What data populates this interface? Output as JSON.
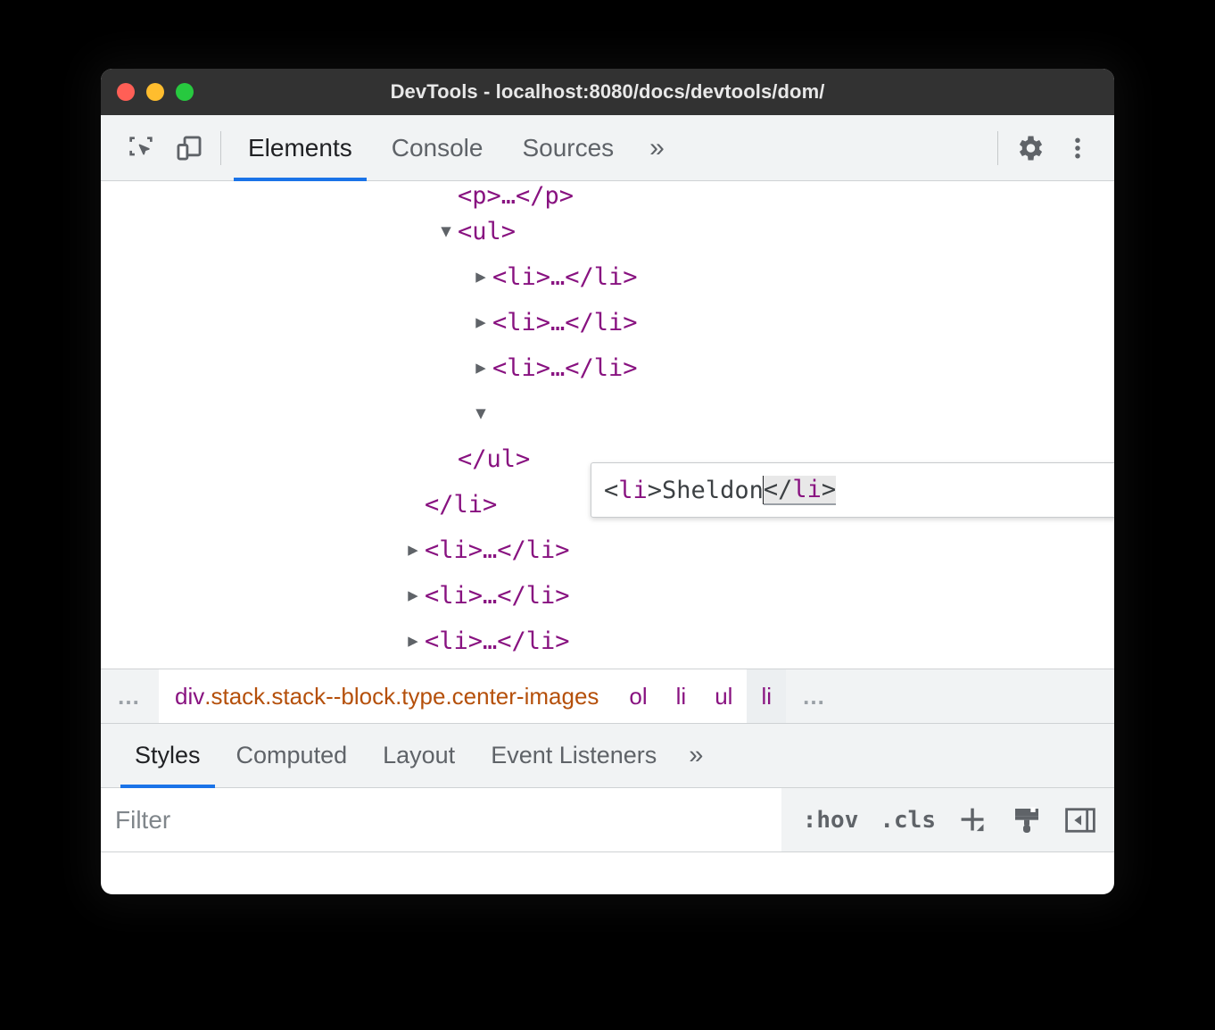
{
  "window": {
    "title": "DevTools - localhost:8080/docs/devtools/dom/",
    "traffic_lights": [
      {
        "name": "close",
        "color": "#ff5f56"
      },
      {
        "name": "minimize",
        "color": "#ffbd2e"
      },
      {
        "name": "zoom",
        "color": "#27c93f"
      }
    ]
  },
  "toolbar": {
    "inspect_icon": "inspect-element-icon",
    "device_icon": "device-toolbar-icon",
    "settings_icon": "gear-icon",
    "more_icon": "kebab-menu-icon",
    "tabs": [
      {
        "label": "Elements",
        "active": true
      },
      {
        "label": "Console",
        "active": false
      },
      {
        "label": "Sources",
        "active": false
      }
    ],
    "more_tabs_label": "»"
  },
  "dom_tree": {
    "rows": [
      {
        "id": "p-row",
        "twisty": "",
        "indent": 3,
        "text": "<p>…</p>",
        "clipped": true
      },
      {
        "id": "ul-open",
        "twisty": "▼",
        "indent": 3,
        "text": "<ul>"
      },
      {
        "id": "li-1",
        "twisty": "▶",
        "indent": 4,
        "text": "<li>…</li>"
      },
      {
        "id": "li-2",
        "twisty": "▶",
        "indent": 4,
        "text": "<li>…</li>"
      },
      {
        "id": "li-3",
        "twisty": "▶",
        "indent": 4,
        "text": "<li>…</li>"
      },
      {
        "id": "li-4-editing",
        "twisty": "▼",
        "indent": 4,
        "text": ""
      },
      {
        "id": "ul-close",
        "twisty": "",
        "indent": 3,
        "text": "</ul>"
      },
      {
        "id": "li-close",
        "twisty": "",
        "indent": 2,
        "text": "</li>"
      },
      {
        "id": "li-5",
        "twisty": "▶",
        "indent": 2,
        "text": "<li>…</li>"
      },
      {
        "id": "li-6",
        "twisty": "▶",
        "indent": 2,
        "text": "<li>…</li>"
      },
      {
        "id": "li-7",
        "twisty": "▶",
        "indent": 2,
        "text": "<li>…</li>"
      }
    ]
  },
  "editor": {
    "open_lt": "<",
    "open_tag": "li",
    "open_gt": ">",
    "content": "Sheldon",
    "close_lt": "</",
    "close_tag": "li",
    "close_gt": ">",
    "full_value": "<li>Sheldon</li>"
  },
  "breadcrumb": {
    "left_ellipsis": "…",
    "items": [
      {
        "tag": "div",
        "classes": ".stack.stack--block.type.center-images",
        "selected": false,
        "wide": true
      },
      {
        "tag": "ol",
        "classes": "",
        "selected": false
      },
      {
        "tag": "li",
        "classes": "",
        "selected": false
      },
      {
        "tag": "ul",
        "classes": "",
        "selected": false
      },
      {
        "tag": "li",
        "classes": "",
        "selected": true
      }
    ],
    "right_ellipsis": "…"
  },
  "styles_pane": {
    "tabs": [
      {
        "label": "Styles",
        "active": true
      },
      {
        "label": "Computed",
        "active": false
      },
      {
        "label": "Layout",
        "active": false
      },
      {
        "label": "Event Listeners",
        "active": false
      }
    ],
    "more_tabs_label": "»",
    "filter": {
      "value": "",
      "placeholder": "Filter"
    },
    "hov_label": ":hov",
    "cls_label": ".cls",
    "new_rule_icon": "plus-icon",
    "copy_styles_icon": "paint-brush-icon",
    "sidebar_toggle_icon": "sidebar-collapse-icon"
  },
  "colors": {
    "accent": "#1a73e8",
    "tag": "#881280",
    "class_name": "#b5500b",
    "titlebar": "#323232",
    "toolbar_bg": "#f1f3f4"
  }
}
